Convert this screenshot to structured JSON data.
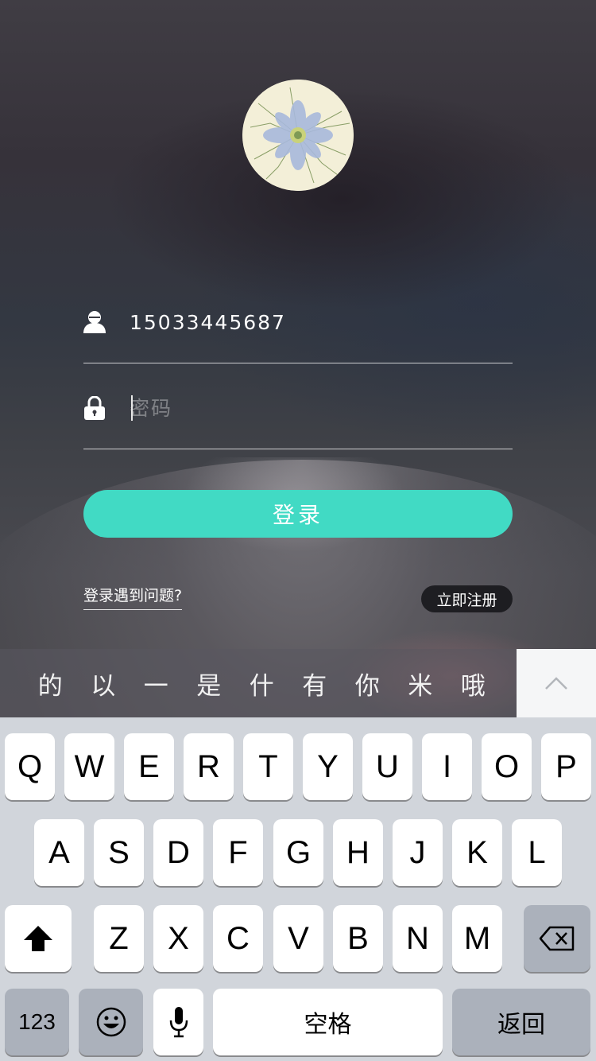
{
  "login": {
    "username_value": "15033445687",
    "password_placeholder": "密码",
    "login_label": "登录",
    "help_label": "登录遇到问题?",
    "register_label": "立即注册"
  },
  "keyboard": {
    "candidates": [
      "的",
      "以",
      "一",
      "是",
      "什",
      "有",
      "你",
      "米",
      "哦"
    ],
    "row1": [
      "Q",
      "W",
      "E",
      "R",
      "T",
      "Y",
      "U",
      "I",
      "O",
      "P"
    ],
    "row2": [
      "A",
      "S",
      "D",
      "F",
      "G",
      "H",
      "J",
      "K",
      "L"
    ],
    "row3": [
      "Z",
      "X",
      "C",
      "V",
      "B",
      "N",
      "M"
    ],
    "numbers_label": "123",
    "space_label": "空格",
    "return_label": "返回"
  },
  "colors": {
    "accent": "#41dac4",
    "keyboard_bg": "#d1d5db",
    "key_bg": "#ffffff",
    "key_dark_bg": "#abb1bb"
  },
  "icons": {
    "user": "user-icon",
    "lock": "lock-icon",
    "expand": "chevron-up-icon",
    "shift": "shift-icon",
    "delete": "backspace-icon",
    "emoji": "emoji-icon",
    "mic": "microphone-icon"
  }
}
